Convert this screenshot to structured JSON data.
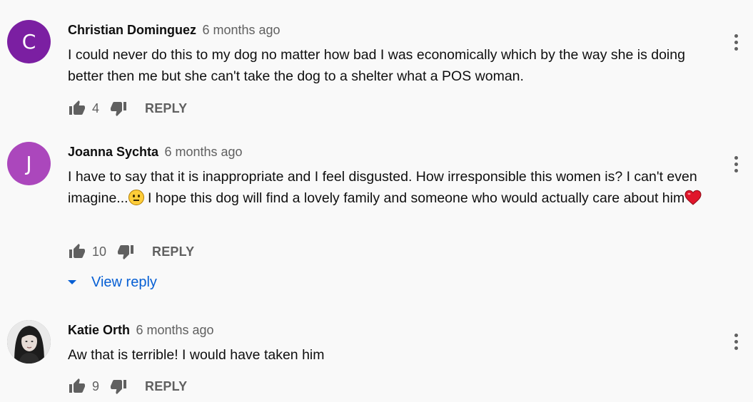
{
  "comments": [
    {
      "avatar_letter": "C",
      "avatar_color": "#7b1fa2",
      "author": "Christian Dominguez",
      "time": "6 months ago",
      "text": "I could never do this to my dog no matter how bad I was economically which by the way she is doing better then me but she can't take the dog to a shelter what a POS woman.",
      "likes": "4",
      "reply_label": "REPLY"
    },
    {
      "avatar_letter": "J",
      "avatar_color": "#ab47bc",
      "author": "Joanna Sychta",
      "time": "6 months ago",
      "text_part1": "I have to say that it is inappropriate and I feel disgusted. How irresponsible this women is? I can't even imagine...",
      "text_part2": " I hope this dog will find a lovely family and someone who would actually care about him",
      "emojis": [
        "neutral-face-emoji",
        "red-heart-emoji"
      ],
      "likes": "10",
      "reply_label": "REPLY",
      "view_reply_label": "View reply"
    },
    {
      "avatar": "profile-photo",
      "author": "Katie Orth",
      "time": "6 months ago",
      "text": "Aw that is terrible! I would have taken him",
      "likes": "9",
      "reply_label": "REPLY"
    }
  ],
  "colors": {
    "background": "#f9f9f9",
    "secondary_text": "#606060",
    "link_blue": "#065fd4"
  },
  "icons": [
    "thumb-up-icon",
    "thumb-down-icon",
    "more-vert-icon",
    "chevron-down-icon"
  ]
}
